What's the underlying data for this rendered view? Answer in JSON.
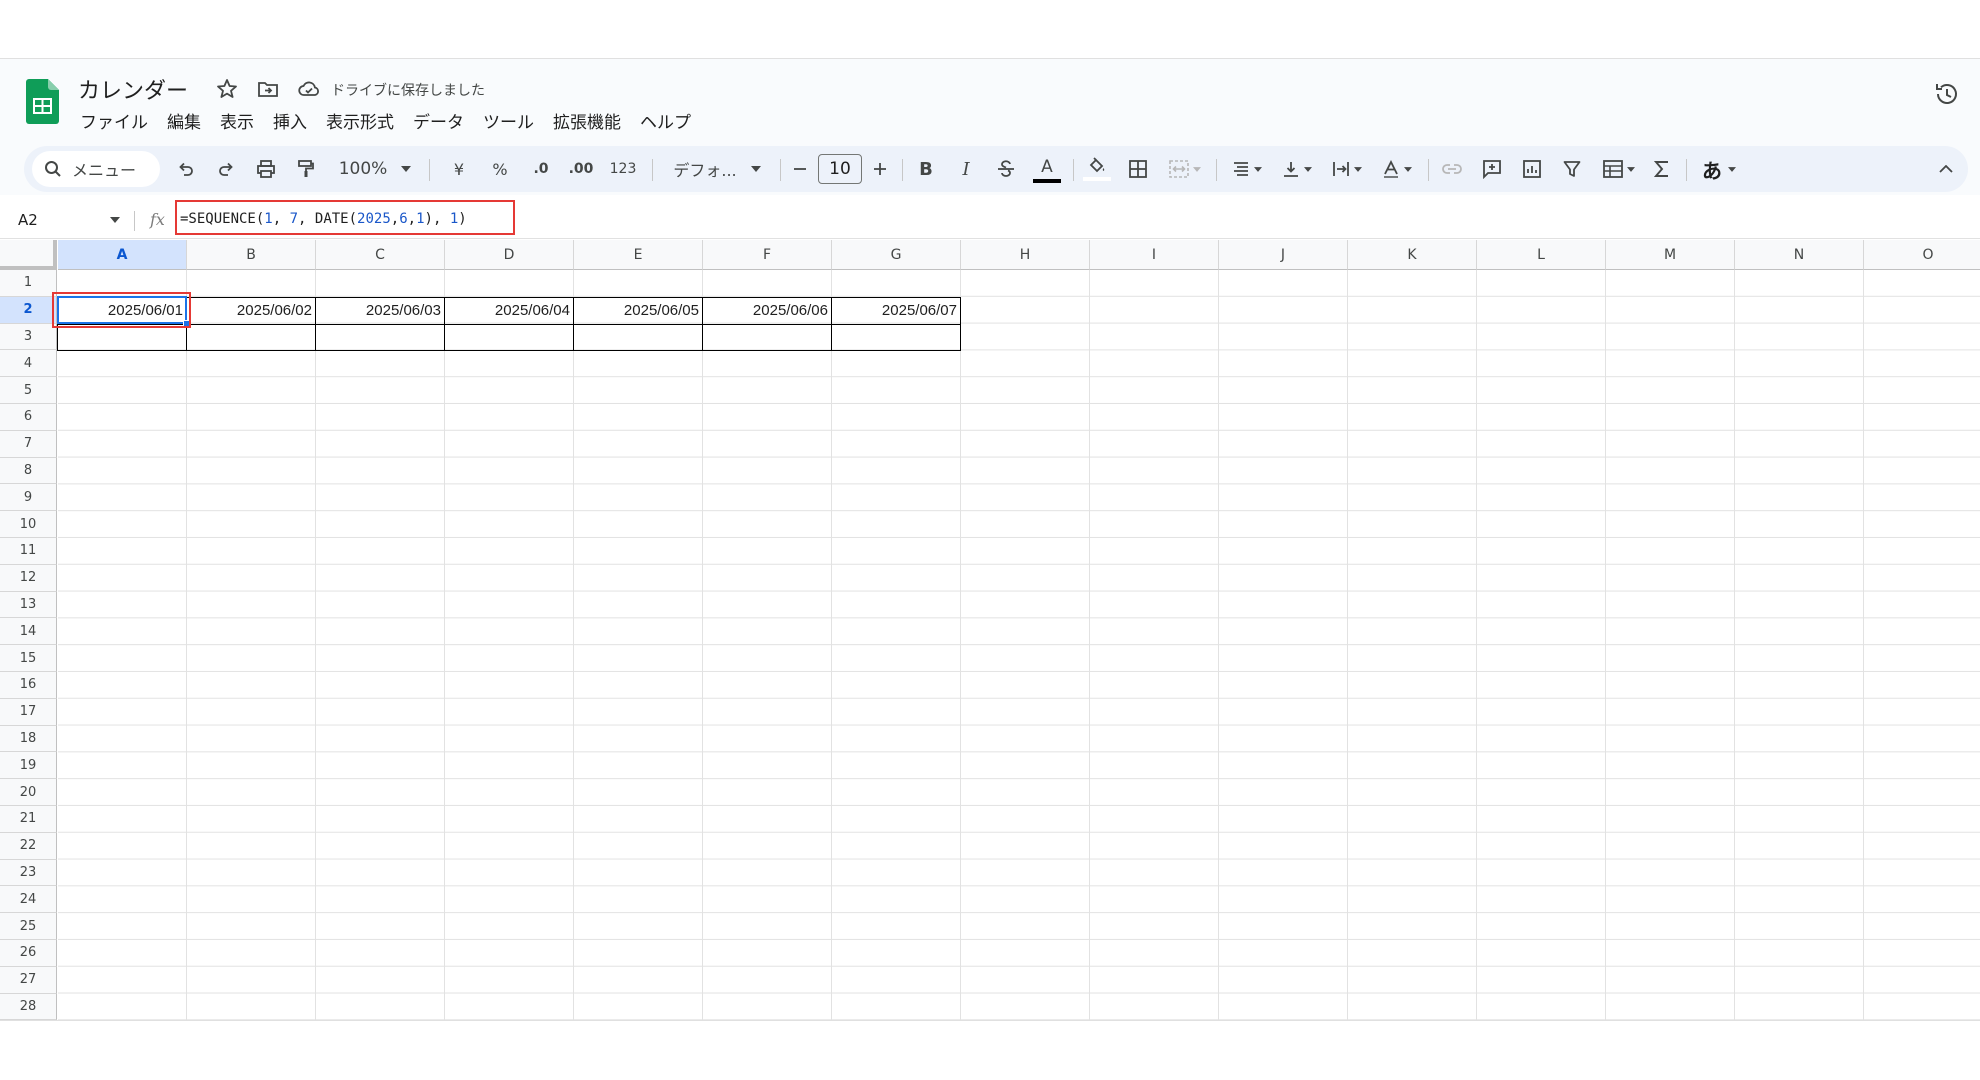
{
  "app": {
    "title": "カレンダー",
    "saved_status": "ドライブに保存しました",
    "brand_color": "#0f9d58"
  },
  "menu": [
    "ファイル",
    "編集",
    "表示",
    "挿入",
    "表示形式",
    "データ",
    "ツール",
    "拡張機能",
    "ヘルプ"
  ],
  "toolbar": {
    "search_label": "メニュー",
    "zoom": "100%",
    "currency": "¥",
    "percent": "%",
    "dec_decrease": ".0",
    "dec_increase": ".00",
    "number_format": "123",
    "font": "デフォ...",
    "font_size": "10",
    "bold": "B",
    "italic": "I",
    "text_color_label": "A",
    "input_tool": "あ"
  },
  "formula_bar": {
    "name_box": "A2",
    "fx": "fx",
    "formula_parts": [
      "=SEQUENCE(",
      "1",
      ", ",
      "7",
      ", DATE(",
      "2025",
      ",",
      "6",
      ",",
      "1",
      "), ",
      "1",
      ")"
    ],
    "accent_color": "#e53935"
  },
  "grid": {
    "columns": [
      "A",
      "B",
      "C",
      "D",
      "E",
      "F",
      "G",
      "H",
      "I",
      "J",
      "K",
      "L",
      "M",
      "N",
      "O"
    ],
    "selected_column": "A",
    "rows": [
      "1",
      "2",
      "3",
      "4",
      "5",
      "6",
      "7",
      "8",
      "9",
      "10",
      "11",
      "12",
      "13",
      "14",
      "15",
      "16",
      "17",
      "18",
      "19",
      "20",
      "21",
      "22",
      "23",
      "24",
      "25",
      "26",
      "27",
      "28"
    ],
    "selected_row": "2",
    "row2_values": [
      "2025/06/01",
      "2025/06/02",
      "2025/06/03",
      "2025/06/04",
      "2025/06/05",
      "2025/06/06",
      "2025/06/07"
    ],
    "selection_color": "#1a73e8"
  }
}
